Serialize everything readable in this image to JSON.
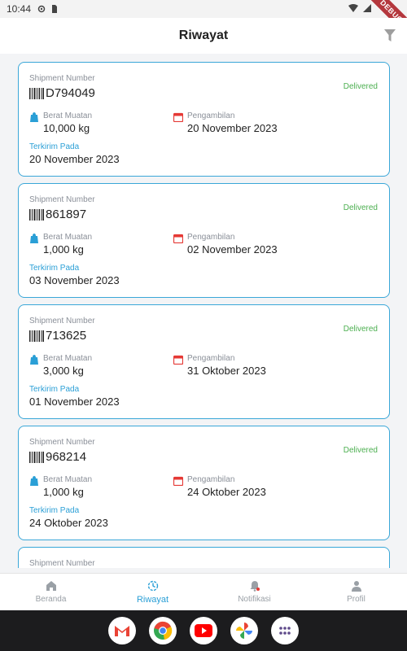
{
  "status_bar": {
    "time": "10:44"
  },
  "debug_banner": "DEBUG",
  "header": {
    "title": "Riwayat"
  },
  "colors": {
    "accent": "#2a9fd6",
    "card_border": "#3aa7d8",
    "delivered": "#4caf50",
    "pickup_icon": "#e53935"
  },
  "labels": {
    "shipment_number": "Shipment Number",
    "weight": "Berat Muatan",
    "pickup": "Pengambilan",
    "sent_on": "Terkirim Pada"
  },
  "shipments": [
    {
      "number": "D794049",
      "status": "Delivered",
      "weight": "10,000 kg",
      "pickup_date": "20 November 2023",
      "sent_date": "20 November 2023"
    },
    {
      "number": "861897",
      "status": "Delivered",
      "weight": "1,000 kg",
      "pickup_date": "02 November 2023",
      "sent_date": "03 November 2023"
    },
    {
      "number": "713625",
      "status": "Delivered",
      "weight": "3,000 kg",
      "pickup_date": "31 Oktober 2023",
      "sent_date": "01 November 2023"
    },
    {
      "number": "968214",
      "status": "Delivered",
      "weight": "1,000 kg",
      "pickup_date": "24 Oktober 2023",
      "sent_date": "24 Oktober 2023"
    }
  ],
  "nav": [
    {
      "label": "Beranda",
      "icon": "home-icon"
    },
    {
      "label": "Riwayat",
      "icon": "history-icon"
    },
    {
      "label": "Notifikasi",
      "icon": "bell-icon"
    },
    {
      "label": "Profil",
      "icon": "person-icon"
    }
  ],
  "dock_apps": [
    "gmail-icon",
    "chrome-icon",
    "youtube-icon",
    "photos-icon",
    "app-drawer-icon"
  ]
}
